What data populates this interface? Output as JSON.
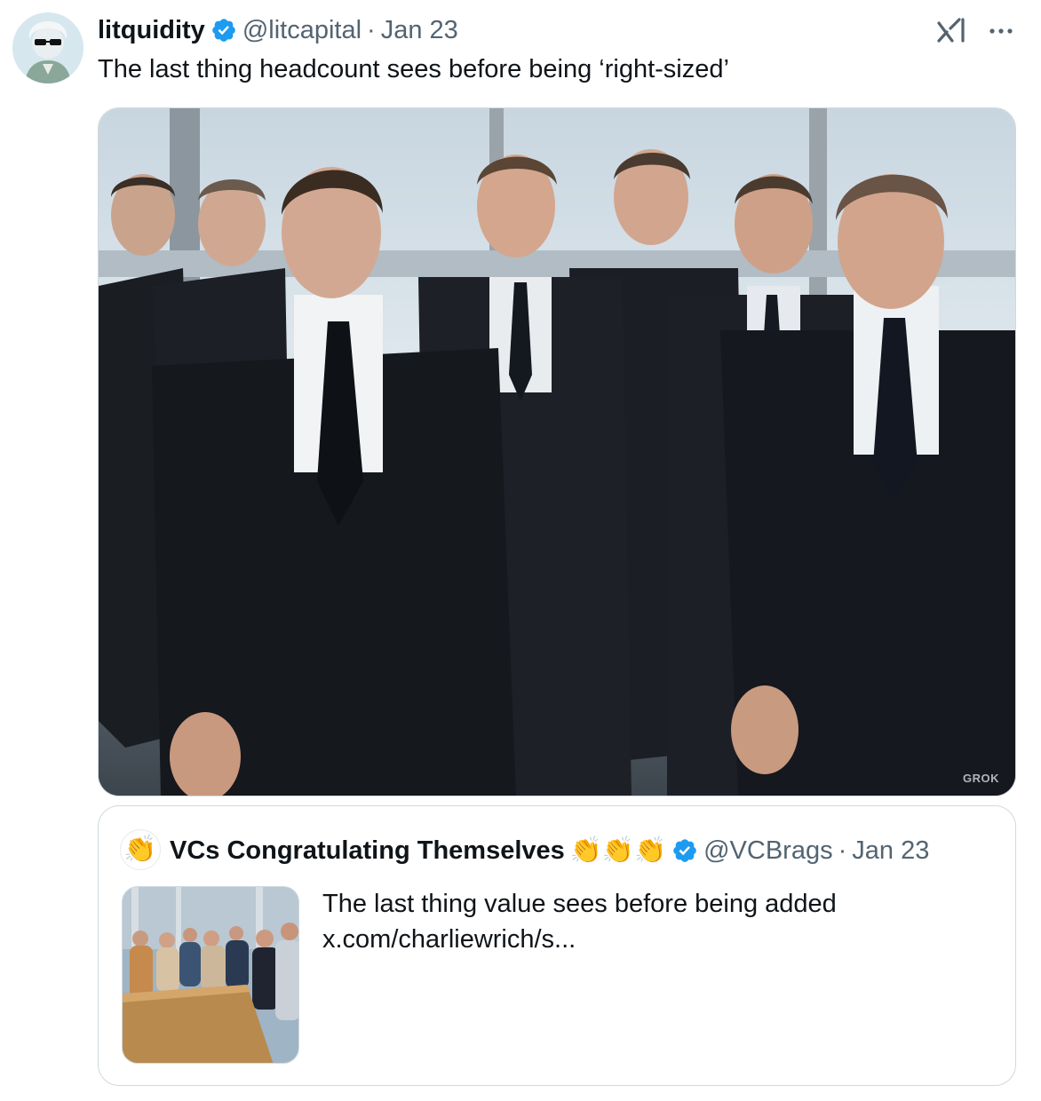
{
  "tweet": {
    "author_name": "litquidity",
    "handle": "@litcapital",
    "separator": "·",
    "date": "Jan 23",
    "text": "The last thing headcount sees before being ‘right-sized’",
    "more_icon": "more-horizontal-icon",
    "media_watermark": "GROK"
  },
  "quoted_tweet": {
    "author_name": "VCs Congratulating Themselves",
    "emoji_suffix": "👏👏👏",
    "avatar_emoji": "👏",
    "handle": "@VCBrags",
    "separator": "·",
    "date": "Jan 23",
    "text_line1": "The last thing value sees before being added",
    "text_line2": "x.com/charliewrich/s..."
  },
  "colors": {
    "text_primary": "#0f1419",
    "text_secondary": "#536471",
    "border": "#cfd9de",
    "verified_blue": "#1d9bf0"
  }
}
